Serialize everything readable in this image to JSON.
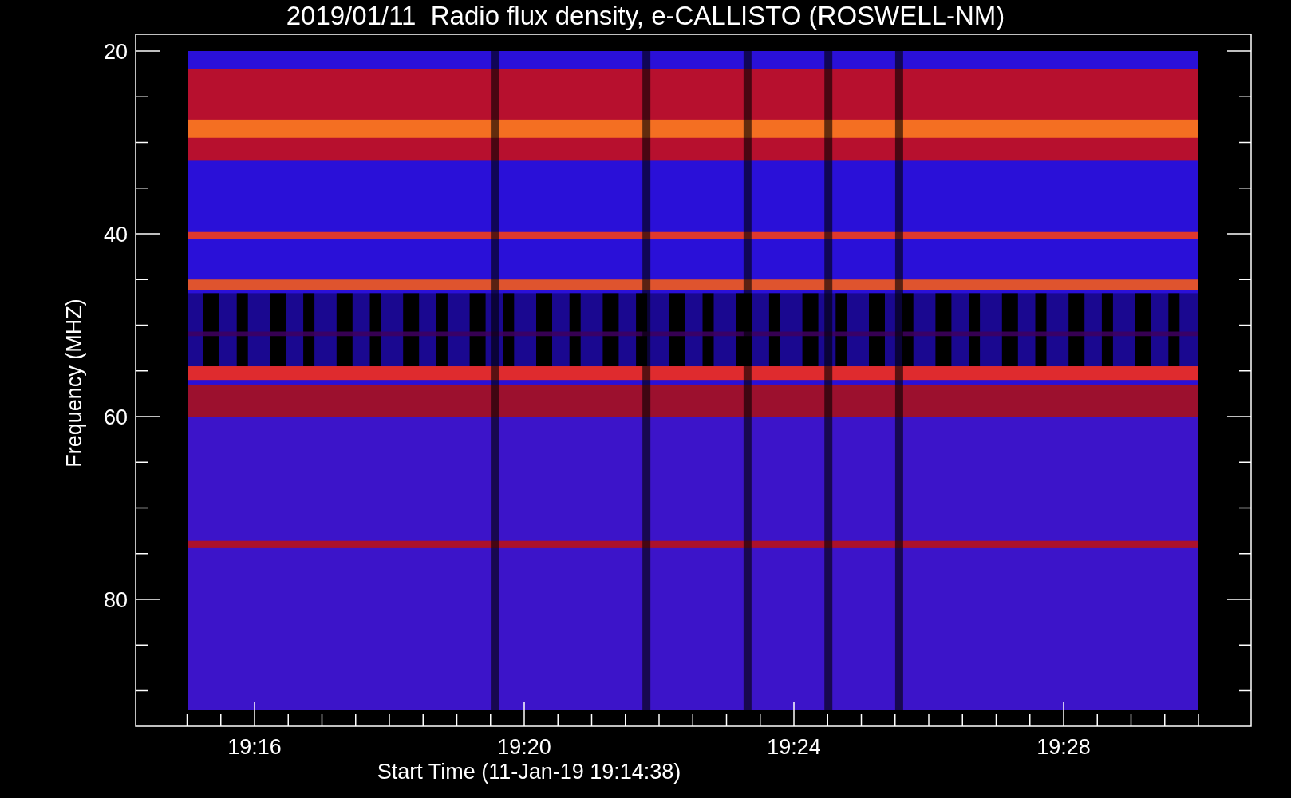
{
  "title": "2019/01/11  Radio flux density, e-CALLISTO (ROSWELL-NM)",
  "y_axis": {
    "label": "Frequency (MHZ)",
    "tick_labels": [
      "20",
      "40",
      "60",
      "80"
    ]
  },
  "x_axis": {
    "label": "Start Time (11-Jan-19 19:14:38)",
    "tick_labels": [
      "19:16",
      "19:20",
      "19:24",
      "19:28"
    ]
  }
}
